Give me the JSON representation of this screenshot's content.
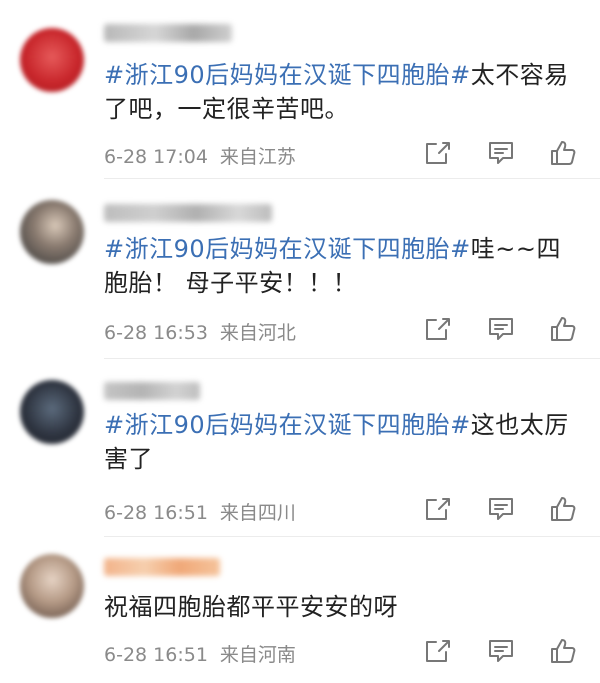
{
  "comments": [
    {
      "topic": "#浙江90后妈妈在汉诞下四胞胎#",
      "text": "太不容易了吧，一定很辛苦吧。",
      "date": "6-28 17:04",
      "source": "来自江苏",
      "avatar_color": "#c8262b",
      "name_colors": [
        "#b8b8b8",
        "#d6d6d6",
        "#a8a8a8"
      ]
    },
    {
      "topic": "#浙江90后妈妈在汉诞下四胞胎#",
      "text": "哇~~四胞胎！ 母子平安！！！",
      "date": "6-28 16:53",
      "source": "来自河北",
      "avatar_color": "#7a6f66",
      "name_colors": [
        "#bdbdbd",
        "#cfcfcf",
        "#b0b0b0"
      ]
    },
    {
      "topic": "#浙江90后妈妈在汉诞下四胞胎#",
      "text": "这也太厉害了",
      "date": "6-28 16:51",
      "source": "来自四川",
      "avatar_color": "#2e3440",
      "name_colors": [
        "#c4c4c4",
        "#b4b4b4",
        "#d2d2d2"
      ]
    },
    {
      "topic": "",
      "text": "祝福四胞胎都平平安安的呀",
      "date": "6-28 16:51",
      "source": "来自河南",
      "avatar_color": "#b59a86",
      "name_colors": [
        "#f2b38a",
        "#f6cfae",
        "#f0a878"
      ]
    }
  ],
  "icons": {
    "repost": "share-icon",
    "comment": "comment-icon",
    "like": "like-icon"
  }
}
